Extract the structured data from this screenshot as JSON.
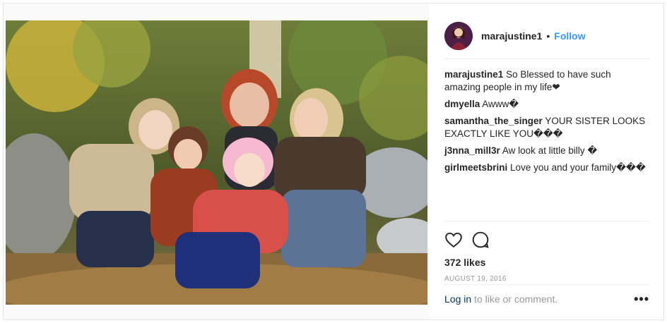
{
  "post": {
    "username": "marajustine1",
    "separator": "•",
    "follow_label": "Follow",
    "photo_description_icon": "photo"
  },
  "comments": [
    {
      "user": "marajustine1",
      "text": "So Blessed to have such amazing people in my life❤"
    },
    {
      "user": "dmyella",
      "text": "Awww�"
    },
    {
      "user": "samantha_the_singer",
      "text": "YOUR SISTER LOOKS EXACTLY LIKE YOU���"
    },
    {
      "user": "j3nna_mill3r",
      "text": "Aw look at little billy �"
    },
    {
      "user": "girlmeetsbrini",
      "text": "Love you and your family���"
    }
  ],
  "actions": {
    "like_icon": "heart-icon",
    "comment_icon": "comment-icon",
    "likes_label": "372 likes",
    "date": "AUGUST 19, 2016"
  },
  "footer": {
    "login_link": "Log in",
    "login_rest": "to like or comment.",
    "more_label": "•••"
  },
  "colors": {
    "link_blue": "#3897f0",
    "text": "#262626",
    "muted": "#999999"
  }
}
